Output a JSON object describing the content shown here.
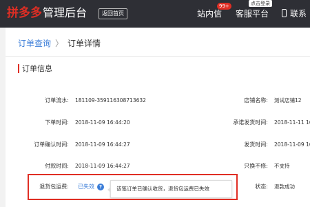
{
  "header": {
    "logo_text": "拼多多",
    "admin_text": "管理后台",
    "home_button": "返回首页",
    "site_message": "站内信",
    "site_message_badge": "99+",
    "customer_service": "客服平台",
    "cs_badge": "点击登录",
    "contact": "联系"
  },
  "breadcrumb": {
    "parent": "订单查询",
    "sep": "〉",
    "current": "订单详情"
  },
  "section": {
    "title": "订单信息"
  },
  "rows_left": [
    {
      "label": "订单流水:",
      "value": "181109-359116308713632"
    },
    {
      "label": "下单时间:",
      "value": "2018-11-09 16:44:20"
    },
    {
      "label": "订单确认时间:",
      "value": "2018-11-09 16:44:27"
    },
    {
      "label": "付款时间:",
      "value": "2018-11-09 16:44:27"
    },
    {
      "label": "退货包运费:",
      "value": ""
    }
  ],
  "rows_right": [
    {
      "label": "店铺名称:",
      "value": "测试店铺12"
    },
    {
      "label": "承诺发货时间:",
      "value": "2018-11-11 16"
    },
    {
      "label": "发货时间:",
      "value": "2018-11-09 16"
    },
    {
      "label": "只换不修:",
      "value": "不支持"
    },
    {
      "label": "状态:",
      "value": "退款成功"
    }
  ],
  "return_shipping": {
    "status_link": "已失效",
    "help_icon": "question-icon",
    "tooltip": "该笔订单已确认收货，退货包运费已失效"
  },
  "colors": {
    "brand_red": "#e02e24",
    "link_blue": "#3b7dd8",
    "topbar": "#2e2f35"
  }
}
